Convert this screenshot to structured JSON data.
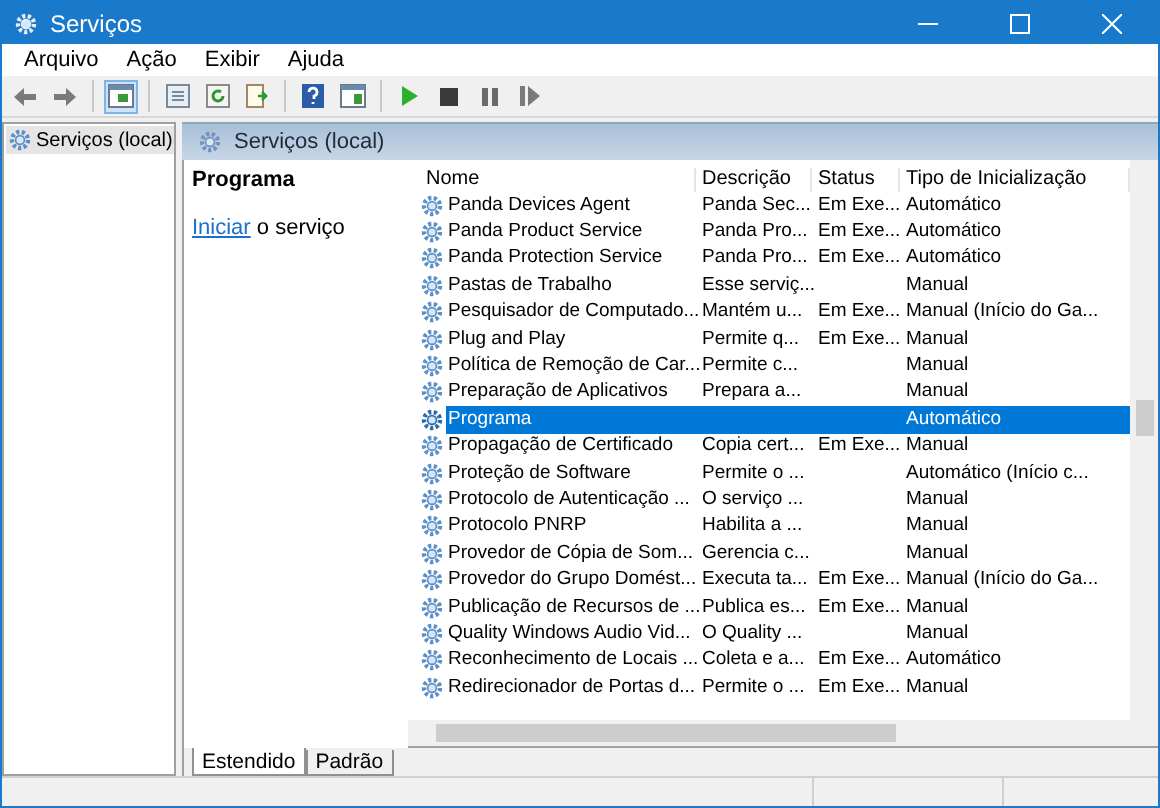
{
  "window": {
    "title": "Serviços"
  },
  "menu": [
    "Arquivo",
    "Ação",
    "Exibir",
    "Ajuda"
  ],
  "toolbar": [
    {
      "kind": "back",
      "selected": false
    },
    {
      "kind": "forward",
      "selected": false
    },
    {
      "kind": "sep"
    },
    {
      "kind": "tree",
      "selected": true
    },
    {
      "kind": "sep"
    },
    {
      "kind": "properties",
      "selected": false
    },
    {
      "kind": "refresh",
      "selected": false
    },
    {
      "kind": "export",
      "selected": false
    },
    {
      "kind": "sep"
    },
    {
      "kind": "help",
      "selected": false
    },
    {
      "kind": "pane",
      "selected": false
    },
    {
      "kind": "sep"
    },
    {
      "kind": "start",
      "selected": false
    },
    {
      "kind": "stop",
      "selected": false
    },
    {
      "kind": "pause",
      "selected": false
    },
    {
      "kind": "resume",
      "selected": false
    }
  ],
  "tree": {
    "items": [
      {
        "label": "Serviços (local)",
        "selected": true
      }
    ]
  },
  "pane_header": {
    "title": "Serviços (local)"
  },
  "details": {
    "title": "Programa",
    "link": "Iniciar",
    "text": " o serviço"
  },
  "table": {
    "columns": [
      "Nome",
      "Descrição",
      "Status",
      "Tipo de Inicialização"
    ],
    "rows": [
      {
        "name": "Panda Devices Agent",
        "description": "Panda Sec...",
        "status": "Em Exe...",
        "startup": "Automático",
        "selected": false
      },
      {
        "name": "Panda Product Service",
        "description": "Panda Pro...",
        "status": "Em Exe...",
        "startup": "Automático",
        "selected": false
      },
      {
        "name": "Panda Protection Service",
        "description": "Panda Pro...",
        "status": "Em Exe...",
        "startup": "Automático",
        "selected": false
      },
      {
        "name": "Pastas de Trabalho",
        "description": "Esse serviç...",
        "status": "",
        "startup": "Manual",
        "selected": false
      },
      {
        "name": "Pesquisador de Computado...",
        "description": "Mantém u...",
        "status": "Em Exe...",
        "startup": "Manual (Início do Ga...",
        "selected": false
      },
      {
        "name": "Plug and Play",
        "description": "Permite q...",
        "status": "Em Exe...",
        "startup": "Manual",
        "selected": false
      },
      {
        "name": "Política de Remoção de Car...",
        "description": "Permite c...",
        "status": "",
        "startup": "Manual",
        "selected": false
      },
      {
        "name": "Preparação de Aplicativos",
        "description": "Prepara a...",
        "status": "",
        "startup": "Manual",
        "selected": false
      },
      {
        "name": "Programa",
        "description": "",
        "status": "",
        "startup": "Automático",
        "selected": true
      },
      {
        "name": "Propagação de Certificado",
        "description": "Copia cert...",
        "status": "Em Exe...",
        "startup": "Manual",
        "selected": false
      },
      {
        "name": "Proteção de Software",
        "description": "Permite o ...",
        "status": "",
        "startup": "Automático (Início c...",
        "selected": false
      },
      {
        "name": "Protocolo de Autenticação ...",
        "description": "O serviço ...",
        "status": "",
        "startup": "Manual",
        "selected": false
      },
      {
        "name": "Protocolo PNRP",
        "description": "Habilita a ...",
        "status": "",
        "startup": "Manual",
        "selected": false
      },
      {
        "name": "Provedor de Cópia de Som...",
        "description": "Gerencia c...",
        "status": "",
        "startup": "Manual",
        "selected": false
      },
      {
        "name": "Provedor do Grupo Domést...",
        "description": "Executa ta...",
        "status": "Em Exe...",
        "startup": "Manual (Início do Ga...",
        "selected": false
      },
      {
        "name": "Publicação de Recursos de ...",
        "description": "Publica es...",
        "status": "Em Exe...",
        "startup": "Manual",
        "selected": false
      },
      {
        "name": "Quality Windows Audio Vid...",
        "description": "O Quality ...",
        "status": "",
        "startup": "Manual",
        "selected": false
      },
      {
        "name": "Reconhecimento de Locais ...",
        "description": "Coleta e a...",
        "status": "Em Exe...",
        "startup": "Automático",
        "selected": false
      },
      {
        "name": "Redirecionador de Portas d...",
        "description": "Permite o ...",
        "status": "Em Exe...",
        "startup": "Manual",
        "selected": false
      }
    ]
  },
  "view_tabs": [
    {
      "label": "Estendido",
      "selected": true
    },
    {
      "label": "Padrão",
      "selected": false
    }
  ]
}
